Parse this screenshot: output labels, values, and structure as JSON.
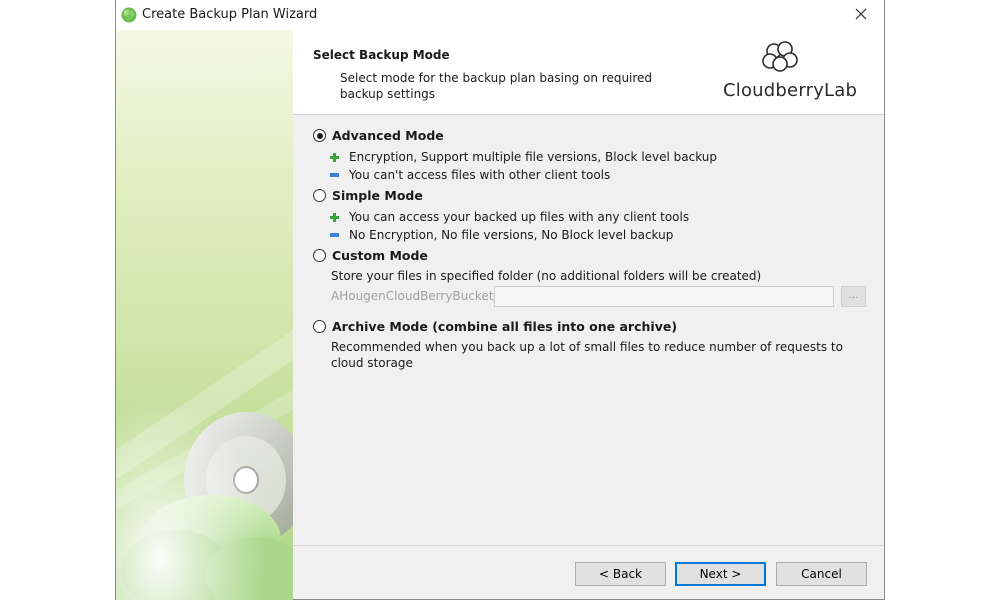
{
  "window": {
    "title": "Create Backup Plan Wizard"
  },
  "header": {
    "title": "Select Backup Mode",
    "subtitle": "Select mode for the backup plan basing on required backup settings",
    "logo_text": "CloudberryLab"
  },
  "modes": {
    "advanced": {
      "label": "Advanced Mode",
      "selected": true,
      "pros": "Encryption, Support multiple file versions, Block level backup",
      "cons": "You can't access files with other client tools"
    },
    "simple": {
      "label": "Simple Mode",
      "selected": false,
      "pros": "You can access your backed up files with any client tools",
      "cons": "No Encryption, No file versions, No Block level backup"
    },
    "custom": {
      "label": "Custom Mode",
      "selected": false,
      "description": "Store your files in specified folder (no additional folders will be created)",
      "path_prefix": "AHougenCloudBerryBucket/",
      "path_value": "",
      "browse_label": "..."
    },
    "archive": {
      "label": "Archive Mode (combine all files into one archive)",
      "selected": false,
      "description": "Recommended when you back up a lot of small files to reduce number of requests to cloud storage"
    }
  },
  "buttons": {
    "back": "< Back",
    "next": "Next >",
    "cancel": "Cancel"
  },
  "colors": {
    "plus": "#3aa33a",
    "minus": "#3b7fd4",
    "default_button_border": "#0078d7"
  }
}
